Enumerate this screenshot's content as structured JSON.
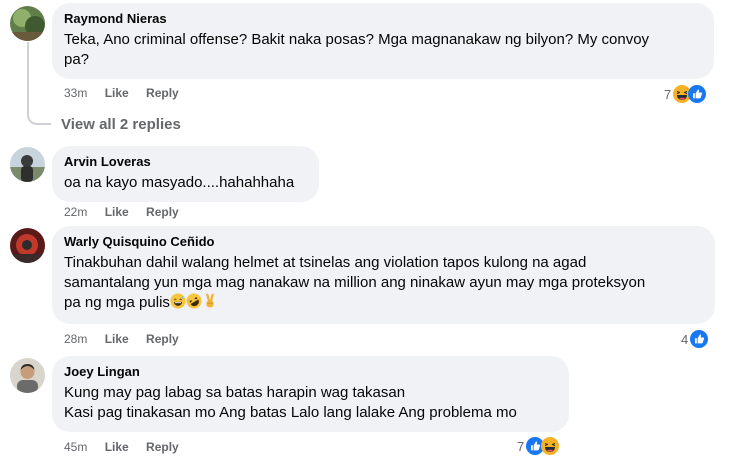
{
  "comments": [
    {
      "author": "Raymond Nieras",
      "lines": [
        "Teka, Ano criminal offense? Bakit naka posas? Mga magnanakaw ng bilyon? My convoy",
        "pa?"
      ],
      "time": "33m",
      "like": "Like",
      "reply": "Reply",
      "reaction_count": "7",
      "reaction_icons": [
        "haha-icon",
        "like-icon"
      ]
    },
    {
      "author": "Arvin Loveras",
      "lines": [
        "oa na kayo masyado....hahahhaha"
      ],
      "time": "22m",
      "like": "Like",
      "reply": "Reply"
    },
    {
      "author": "Warly Quisquino Ceñido",
      "lines": [
        "Tinakbuhan dahil walang helmet at tsinelas ang violation tapos kulong na agad",
        "samantalang yun mga mag nanakaw na million ang ninakaw ayun may mga proteksyon",
        "pa ng mga pulis"
      ],
      "trailing_emojis": [
        "grinning-sweat-emoji",
        "rofl-emoji",
        "victory-hand-emoji"
      ],
      "time": "28m",
      "like": "Like",
      "reply": "Reply",
      "reaction_count": "4",
      "reaction_icons": [
        "like-icon"
      ]
    },
    {
      "author": "Joey Lingan",
      "lines": [
        "Kung may pag labag sa batas harapin wag takasan",
        "Kasi pag tinakasan mo Ang batas Lalo lang lalake Ang problema mo"
      ],
      "time": "45m",
      "like": "Like",
      "reply": "Reply",
      "reaction_count": "7",
      "reaction_icons": [
        "like-icon",
        "haha-icon"
      ]
    }
  ],
  "view_replies": "View all 2 replies",
  "colors": {
    "bubble": "#f0f2f5",
    "meta": "#65676b",
    "like_blue": "#1877f2",
    "haha_yellow": "#f7b125"
  }
}
